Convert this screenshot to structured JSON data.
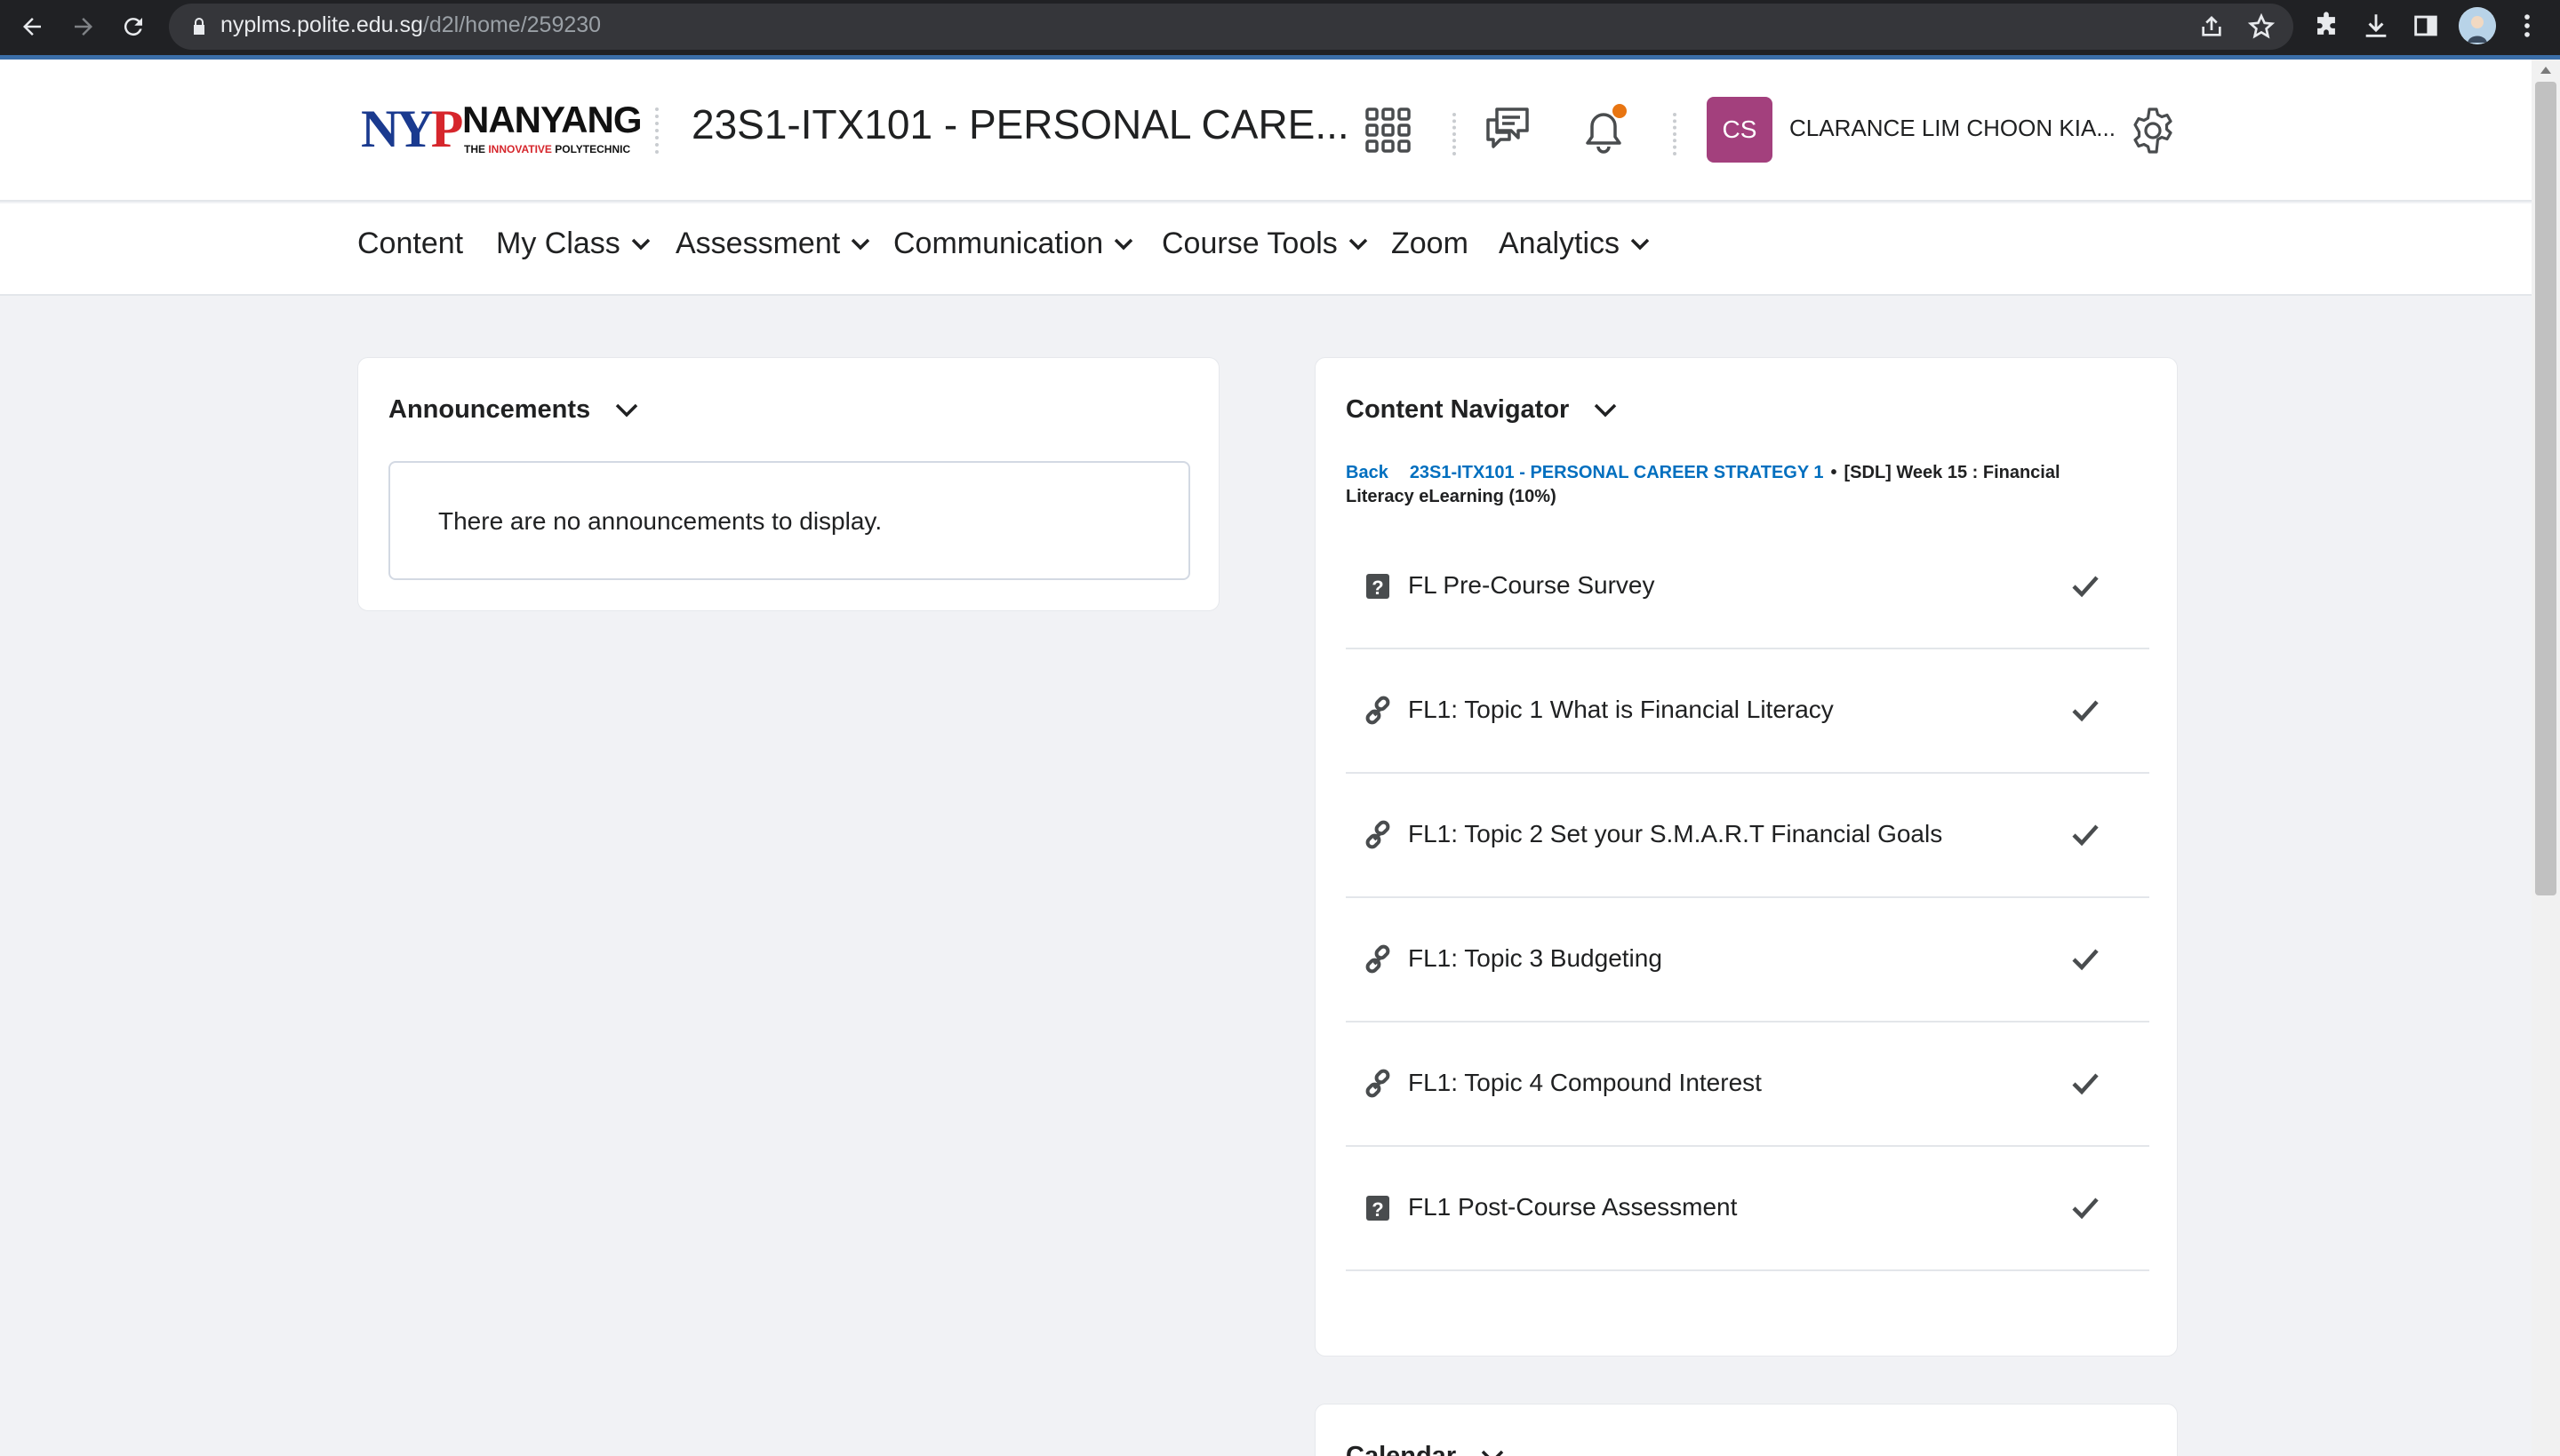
{
  "browser": {
    "url_host": "nyplms.polite.edu.sg",
    "url_path": "/d2l/home/259230",
    "icons": [
      "back-arrow-icon",
      "forward-arrow-icon",
      "reload-icon",
      "lock-icon",
      "share-icon",
      "star-icon",
      "puzzle-icon",
      "download-icon",
      "side-panel-icon",
      "profile-icon",
      "kebab-menu-icon"
    ]
  },
  "header": {
    "logo": {
      "nyp_n": "N",
      "nyp_y": "Y",
      "nyp_p": "P",
      "name": "NANYANG",
      "tag_the": "THE ",
      "tag_innovative": "INNOVATIVE",
      "tag_poly": " POLYTECHNIC"
    },
    "course_title": "23S1-ITX101 - PERSONAL CARE...",
    "avatar_initials": "CS",
    "user_name": "CLARANCE LIM CHOON KIA...",
    "notification_color": "#e87511",
    "avatar_color": "#a3407d"
  },
  "nav": {
    "items": [
      {
        "label": "Content",
        "dropdown": false
      },
      {
        "label": "My Class",
        "dropdown": true
      },
      {
        "label": "Assessment",
        "dropdown": true
      },
      {
        "label": "Communication",
        "dropdown": true
      },
      {
        "label": "Course Tools",
        "dropdown": true
      },
      {
        "label": "Zoom",
        "dropdown": false
      },
      {
        "label": "Analytics",
        "dropdown": true
      }
    ]
  },
  "announcements": {
    "title": "Announcements",
    "empty_text": "There are no announcements to display."
  },
  "content_navigator": {
    "title": "Content Navigator",
    "back_label": "Back",
    "course_link": "23S1-ITX101 - PERSONAL CAREER STRATEGY 1",
    "separator": "•",
    "current_module": "[SDL] Week 15 : Financial Literacy eLearning (10%)",
    "topics": [
      {
        "label": "FL Pre-Course Survey",
        "icon": "quiz-icon",
        "completed": true
      },
      {
        "label": "FL1: Topic 1 What is Financial Literacy",
        "icon": "link-icon",
        "completed": true
      },
      {
        "label": "FL1: Topic 2 Set your S.M.A.R.T Financial Goals",
        "icon": "link-icon",
        "completed": true
      },
      {
        "label": "FL1: Topic 3 Budgeting",
        "icon": "link-icon",
        "completed": true
      },
      {
        "label": "FL1: Topic 4 Compound Interest",
        "icon": "link-icon",
        "completed": true
      },
      {
        "label": "FL1 Post-Course Assessment",
        "icon": "quiz-icon",
        "completed": true
      }
    ]
  },
  "calendar": {
    "title": "Calendar"
  },
  "colors": {
    "link": "#006fbf",
    "page_bg": "#f1f2f5",
    "browser_bar": "#202124"
  }
}
